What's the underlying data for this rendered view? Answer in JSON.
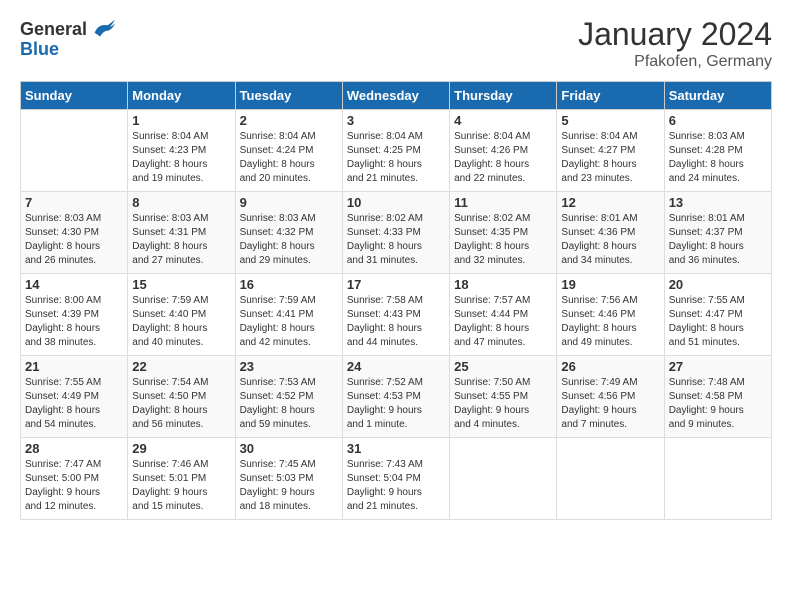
{
  "header": {
    "logo_general": "General",
    "logo_blue": "Blue",
    "month_year": "January 2024",
    "location": "Pfakofen, Germany"
  },
  "weekdays": [
    "Sunday",
    "Monday",
    "Tuesday",
    "Wednesday",
    "Thursday",
    "Friday",
    "Saturday"
  ],
  "weeks": [
    [
      {
        "day": "",
        "info": ""
      },
      {
        "day": "1",
        "info": "Sunrise: 8:04 AM\nSunset: 4:23 PM\nDaylight: 8 hours\nand 19 minutes."
      },
      {
        "day": "2",
        "info": "Sunrise: 8:04 AM\nSunset: 4:24 PM\nDaylight: 8 hours\nand 20 minutes."
      },
      {
        "day": "3",
        "info": "Sunrise: 8:04 AM\nSunset: 4:25 PM\nDaylight: 8 hours\nand 21 minutes."
      },
      {
        "day": "4",
        "info": "Sunrise: 8:04 AM\nSunset: 4:26 PM\nDaylight: 8 hours\nand 22 minutes."
      },
      {
        "day": "5",
        "info": "Sunrise: 8:04 AM\nSunset: 4:27 PM\nDaylight: 8 hours\nand 23 minutes."
      },
      {
        "day": "6",
        "info": "Sunrise: 8:03 AM\nSunset: 4:28 PM\nDaylight: 8 hours\nand 24 minutes."
      }
    ],
    [
      {
        "day": "7",
        "info": "Sunrise: 8:03 AM\nSunset: 4:30 PM\nDaylight: 8 hours\nand 26 minutes."
      },
      {
        "day": "8",
        "info": "Sunrise: 8:03 AM\nSunset: 4:31 PM\nDaylight: 8 hours\nand 27 minutes."
      },
      {
        "day": "9",
        "info": "Sunrise: 8:03 AM\nSunset: 4:32 PM\nDaylight: 8 hours\nand 29 minutes."
      },
      {
        "day": "10",
        "info": "Sunrise: 8:02 AM\nSunset: 4:33 PM\nDaylight: 8 hours\nand 31 minutes."
      },
      {
        "day": "11",
        "info": "Sunrise: 8:02 AM\nSunset: 4:35 PM\nDaylight: 8 hours\nand 32 minutes."
      },
      {
        "day": "12",
        "info": "Sunrise: 8:01 AM\nSunset: 4:36 PM\nDaylight: 8 hours\nand 34 minutes."
      },
      {
        "day": "13",
        "info": "Sunrise: 8:01 AM\nSunset: 4:37 PM\nDaylight: 8 hours\nand 36 minutes."
      }
    ],
    [
      {
        "day": "14",
        "info": "Sunrise: 8:00 AM\nSunset: 4:39 PM\nDaylight: 8 hours\nand 38 minutes."
      },
      {
        "day": "15",
        "info": "Sunrise: 7:59 AM\nSunset: 4:40 PM\nDaylight: 8 hours\nand 40 minutes."
      },
      {
        "day": "16",
        "info": "Sunrise: 7:59 AM\nSunset: 4:41 PM\nDaylight: 8 hours\nand 42 minutes."
      },
      {
        "day": "17",
        "info": "Sunrise: 7:58 AM\nSunset: 4:43 PM\nDaylight: 8 hours\nand 44 minutes."
      },
      {
        "day": "18",
        "info": "Sunrise: 7:57 AM\nSunset: 4:44 PM\nDaylight: 8 hours\nand 47 minutes."
      },
      {
        "day": "19",
        "info": "Sunrise: 7:56 AM\nSunset: 4:46 PM\nDaylight: 8 hours\nand 49 minutes."
      },
      {
        "day": "20",
        "info": "Sunrise: 7:55 AM\nSunset: 4:47 PM\nDaylight: 8 hours\nand 51 minutes."
      }
    ],
    [
      {
        "day": "21",
        "info": "Sunrise: 7:55 AM\nSunset: 4:49 PM\nDaylight: 8 hours\nand 54 minutes."
      },
      {
        "day": "22",
        "info": "Sunrise: 7:54 AM\nSunset: 4:50 PM\nDaylight: 8 hours\nand 56 minutes."
      },
      {
        "day": "23",
        "info": "Sunrise: 7:53 AM\nSunset: 4:52 PM\nDaylight: 8 hours\nand 59 minutes."
      },
      {
        "day": "24",
        "info": "Sunrise: 7:52 AM\nSunset: 4:53 PM\nDaylight: 9 hours\nand 1 minute."
      },
      {
        "day": "25",
        "info": "Sunrise: 7:50 AM\nSunset: 4:55 PM\nDaylight: 9 hours\nand 4 minutes."
      },
      {
        "day": "26",
        "info": "Sunrise: 7:49 AM\nSunset: 4:56 PM\nDaylight: 9 hours\nand 7 minutes."
      },
      {
        "day": "27",
        "info": "Sunrise: 7:48 AM\nSunset: 4:58 PM\nDaylight: 9 hours\nand 9 minutes."
      }
    ],
    [
      {
        "day": "28",
        "info": "Sunrise: 7:47 AM\nSunset: 5:00 PM\nDaylight: 9 hours\nand 12 minutes."
      },
      {
        "day": "29",
        "info": "Sunrise: 7:46 AM\nSunset: 5:01 PM\nDaylight: 9 hours\nand 15 minutes."
      },
      {
        "day": "30",
        "info": "Sunrise: 7:45 AM\nSunset: 5:03 PM\nDaylight: 9 hours\nand 18 minutes."
      },
      {
        "day": "31",
        "info": "Sunrise: 7:43 AM\nSunset: 5:04 PM\nDaylight: 9 hours\nand 21 minutes."
      },
      {
        "day": "",
        "info": ""
      },
      {
        "day": "",
        "info": ""
      },
      {
        "day": "",
        "info": ""
      }
    ]
  ]
}
